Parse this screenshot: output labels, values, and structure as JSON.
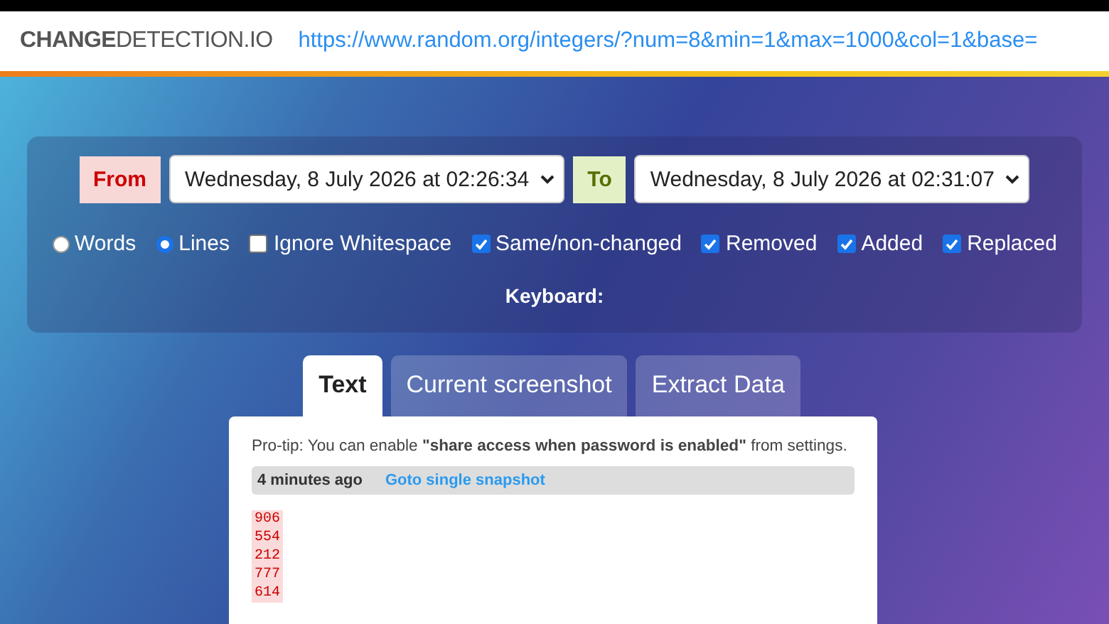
{
  "header": {
    "logo": "**CHANGE**DETECTION.IO",
    "url": "https://www.random.org/integers/?num=8&min=1&max=1000&col=1&base="
  },
  "compare": {
    "from_label": "From",
    "from_value": "Wednesday, 8 July 2026 at 02:26:34",
    "to_label": "To",
    "to_value": "Wednesday, 8 July 2026 at 02:31:07"
  },
  "options": [
    {
      "kind": "radio",
      "label": "Words",
      "selected": false
    },
    {
      "kind": "radio",
      "label": "Lines",
      "selected": true
    },
    {
      "kind": "checkbox",
      "label": "Ignore Whitespace",
      "checked": false
    },
    {
      "kind": "checkbox",
      "label": "Same/non-changed",
      "checked": true
    },
    {
      "kind": "checkbox",
      "label": "Removed",
      "checked": true
    },
    {
      "kind": "checkbox",
      "label": "Added",
      "checked": true
    },
    {
      "kind": "checkbox",
      "label": "Replaced",
      "checked": true
    }
  ],
  "keyboard_label": "Keyboard:",
  "tabs": [
    {
      "label": "Text",
      "selected": true
    },
    {
      "label": "Current screenshot",
      "selected": false
    },
    {
      "label": "Extract Data",
      "selected": false
    }
  ],
  "tip": "Pro-tip: You can enable **\"share access when password is enabled\"** from settings.",
  "snapshot_bar": {
    "age": "4 minutes ago",
    "link": "Goto single snapshot"
  },
  "diff_lines": [
    {
      "kind": "removed",
      "text": "906"
    },
    {
      "kind": "removed",
      "text": "554"
    },
    {
      "kind": "removed",
      "text": "212"
    },
    {
      "kind": "removed",
      "text": "777"
    },
    {
      "kind": "removed",
      "text": "614"
    }
  ]
}
